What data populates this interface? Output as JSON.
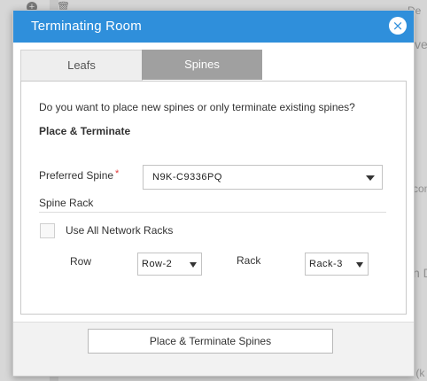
{
  "background": {
    "fragments": [
      "De",
      "ve",
      "con",
      "n D",
      "Power (k"
    ]
  },
  "modal": {
    "title": "Terminating Room",
    "close_glyph": "×",
    "tabs": [
      {
        "label": "Leafs",
        "active": false
      },
      {
        "label": "Spines",
        "active": true
      }
    ],
    "question": "Do you want to place new spines or only terminate existing spines?",
    "section_title": "Place & Terminate",
    "preferred_spine": {
      "label": "Preferred Spine",
      "required_mark": "*",
      "value": "N9K-C9336PQ"
    },
    "spine_rack_label": "Spine Rack",
    "use_all_racks": {
      "label": "Use All Network Racks",
      "checked": false
    },
    "row": {
      "label": "Row",
      "value": "Row-2"
    },
    "rack": {
      "label": "Rack",
      "value": "Rack-3"
    },
    "submit_label": "Place & Terminate Spines"
  },
  "colors": {
    "header": "#2f8fdb",
    "active_tab": "#a0a0a0",
    "required": "#e03a3a"
  }
}
